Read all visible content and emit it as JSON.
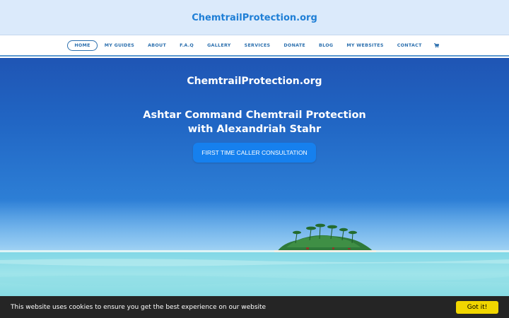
{
  "header": {
    "site_title": "ChemtrailProtection.org"
  },
  "nav": {
    "items": [
      {
        "label": "HOME",
        "active": true
      },
      {
        "label": "MY GUIDES"
      },
      {
        "label": "ABOUT"
      },
      {
        "label": "F.A.Q"
      },
      {
        "label": "GALLERY"
      },
      {
        "label": "SERVICES"
      },
      {
        "label": "DONATE"
      },
      {
        "label": "BLOG"
      },
      {
        "label": "MY WEBSITES"
      },
      {
        "label": "CONTACT"
      }
    ],
    "cart_icon": "shopping-cart-icon"
  },
  "hero": {
    "brand": "ChemtrailProtection.org",
    "heading_line1": "Ashtar Command Chemtrail Protection",
    "heading_line2": "with Alexandriah Stahr",
    "cta_label": "FIRST TIME CALLER CONSULTATION"
  },
  "cookie": {
    "message": "This website uses cookies to ensure you get the best experience on our website",
    "button_label": "Got it!"
  },
  "colors": {
    "accent": "#1f7fd6",
    "nav_text": "#2b6fae",
    "cta": "#1680ee",
    "cookie_bg": "#252525",
    "cookie_button": "#f1d600"
  }
}
